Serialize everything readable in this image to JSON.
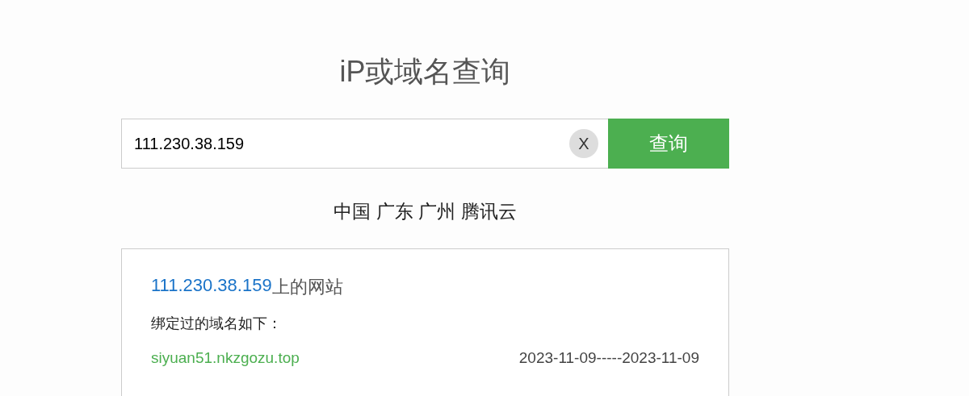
{
  "title": "iP或域名查询",
  "search": {
    "value": "111.230.38.159",
    "clear_label": "X",
    "button": "查询"
  },
  "location": "中国 广东 广州 腾讯云",
  "result": {
    "ip_link": "111.230.38.159",
    "heading_rest": "上的网站",
    "subtitle": "绑定过的域名如下：",
    "domains": [
      {
        "domain": "siyuan51.nkzgozu.top",
        "dates": "2023-11-09-----2023-11-09"
      }
    ]
  }
}
